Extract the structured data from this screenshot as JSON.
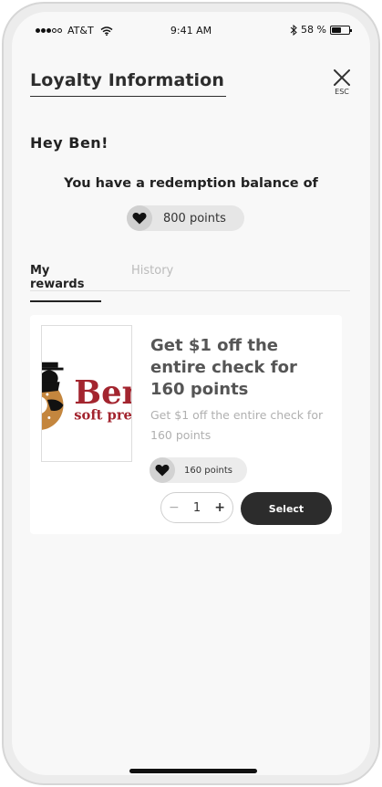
{
  "status_bar": {
    "carrier": "AT&T",
    "time": "9:41 AM",
    "battery_percent": "58 %",
    "battery_level": 0.58
  },
  "header": {
    "title": "Loyalty Information",
    "close_label": "ESC"
  },
  "greeting": "Hey Ben!",
  "balance": {
    "text": "You have a redemption balance of",
    "points": "800 points"
  },
  "tabs": [
    {
      "label": "My rewards",
      "active": true
    },
    {
      "label": "History",
      "active": false
    }
  ],
  "reward": {
    "title": "Get $1 off the entire check for 160 points",
    "description": "Get $1 off the entire check for 160 points",
    "points": "160 points",
    "quantity": "1",
    "minus": "−",
    "plus": "+",
    "select_label": "Select",
    "logo_text_main": "Ben",
    "logo_text_sub": "soft pre"
  },
  "colors": {
    "accent_dark": "#2c2c2c",
    "brand_red": "#a3252f",
    "muted_text": "#b0b0b0"
  }
}
